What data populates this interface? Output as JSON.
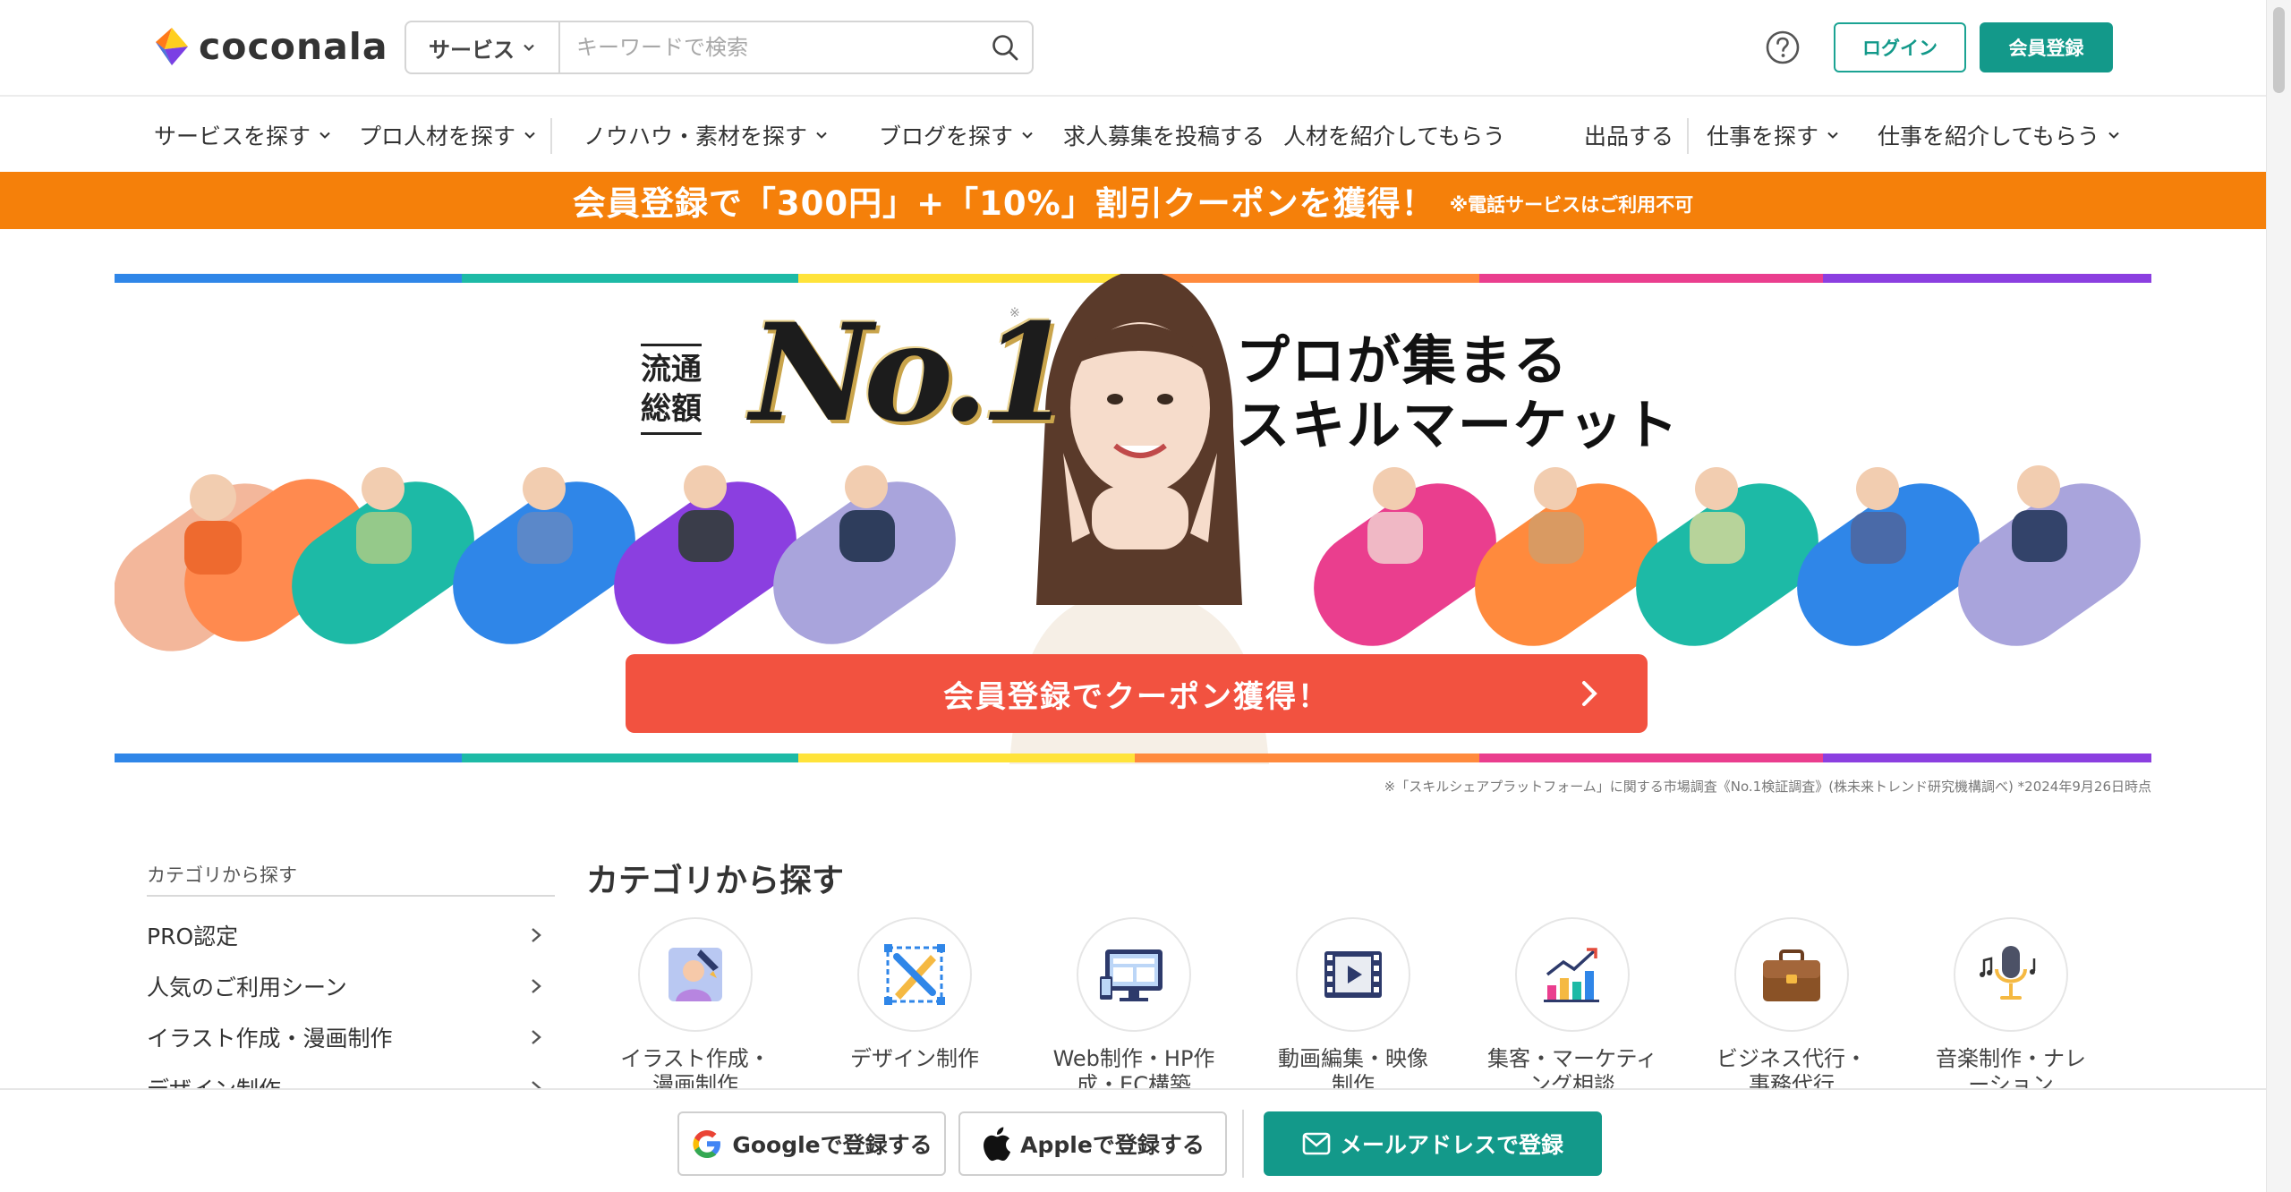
{
  "header": {
    "logo_text": "coconala",
    "search": {
      "category": "サービス",
      "placeholder": "キーワードで検索"
    },
    "login_label": "ログイン",
    "register_label": "会員登録"
  },
  "nav": {
    "items": [
      {
        "label": "サービスを探す",
        "dropdown": true
      },
      {
        "label": "プロ人材を探す",
        "dropdown": true
      },
      {
        "label": "ノウハウ・素材を探す",
        "dropdown": true
      },
      {
        "label": "ブログを探す",
        "dropdown": true
      },
      {
        "label": "求人募集を投稿する",
        "dropdown": false
      },
      {
        "label": "人材を紹介してもらう",
        "dropdown": false
      },
      {
        "label": "出品する",
        "dropdown": false
      },
      {
        "label": "仕事を探す",
        "dropdown": true
      },
      {
        "label": "仕事を紹介してもらう",
        "dropdown": true
      }
    ]
  },
  "promo": {
    "main": "会員登録で「300円」+「10%」割引クーポンを獲得！",
    "note": "※電話サービスはご利用不可"
  },
  "hero": {
    "rank_label": "流通総額",
    "rank_value": "No.1",
    "rank_mark": "※",
    "headline_line1": "プロが集まる",
    "headline_line2": "スキルマーケット",
    "cta_label": "会員登録でクーポン獲得！",
    "footnote": "※「スキルシェアプラットフォーム」に関する市場調査《No.1検証調査》(株未来トレンド研究機構調べ) *2024年9月26日時点",
    "colors": {
      "blue": "#2f86e8",
      "teal": "#1dbaa6",
      "yellow": "#ffe33a",
      "orange": "#ff8a3d",
      "pink": "#ea3e8e",
      "purple": "#8b3fe0",
      "lavender": "#a9a4dc",
      "cta": "#f25240"
    }
  },
  "sidebar": {
    "title": "カテゴリから探す",
    "items": [
      {
        "label": "PRO認定"
      },
      {
        "label": "人気のご利用シーン"
      },
      {
        "label": "イラスト作成・漫画制作"
      },
      {
        "label": "デザイン制作"
      }
    ]
  },
  "categories": {
    "heading": "カテゴリから探す",
    "items": [
      {
        "line1": "イラスト作成・",
        "line2": "漫画制作",
        "icon": "illustration-icon"
      },
      {
        "line1": "デザイン制作",
        "line2": "",
        "icon": "design-icon"
      },
      {
        "line1": "Web制作・HP作",
        "line2": "成・EC構築",
        "icon": "web-icon"
      },
      {
        "line1": "動画編集・映像",
        "line2": "制作",
        "icon": "video-icon"
      },
      {
        "line1": "集客・マーケティ",
        "line2": "ング相談",
        "icon": "marketing-icon"
      },
      {
        "line1": "ビジネス代行・",
        "line2": "事務代行",
        "icon": "business-icon"
      },
      {
        "line1": "音楽制作・ナレ",
        "line2": "ーション",
        "icon": "music-icon"
      }
    ]
  },
  "bottom_bar": {
    "google_label": "Googleで登録する",
    "apple_label": "Appleで登録する",
    "mail_label": "メールアドレスで登録"
  },
  "colors": {
    "brand_green": "#13998a",
    "promo_orange": "#f5800a"
  }
}
